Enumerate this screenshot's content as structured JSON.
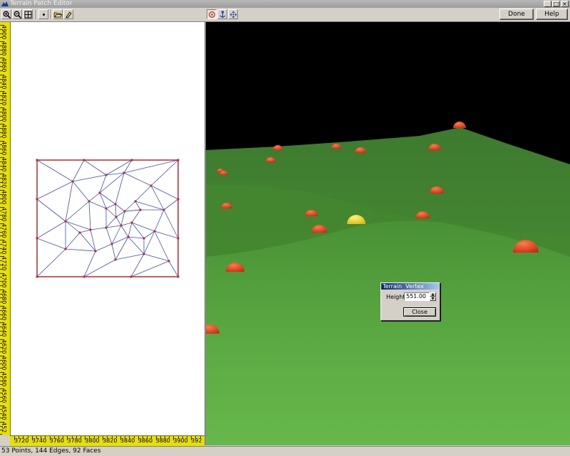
{
  "window": {
    "title": "Terrain Patch Editor",
    "controls": [
      "_",
      "□",
      "×"
    ]
  },
  "toolbar": {
    "left_tools": [
      "zoom-in-icon",
      "zoom-out-icon",
      "zoom-extents-icon",
      "point-icon",
      "open-folder-icon",
      "paint-icon"
    ],
    "view_tools": [
      "orbit-icon",
      "anchor-icon",
      "pan-icon"
    ],
    "done_label": "Done",
    "help_label": "Help"
  },
  "ruler_left": {
    "labels": [
      "4900",
      "4880",
      "4860",
      "4840",
      "4820",
      "4800",
      "4880",
      "4860",
      "4840",
      "4820",
      "4800",
      "4780",
      "4760",
      "4740",
      "4720",
      "4700",
      "4680",
      "4660",
      "4640",
      "4620",
      "4600",
      "4580",
      "4560",
      "4540",
      "452"
    ]
  },
  "ruler_bottom": {
    "labels": [
      "3720",
      "3740",
      "3760",
      "3780",
      "3800",
      "3820",
      "3840",
      "3860",
      "3880",
      "3900",
      "392"
    ]
  },
  "colors": {
    "sky": "#000000",
    "terrain_dark": "#3f7e30",
    "terrain_light": "#66b54a",
    "vertex_marker": "#e8401e",
    "selected_marker": "#f2d21a",
    "mesh_edge": "#3a4fc8",
    "boundary": "#c0282a",
    "ruler": "#e8e000"
  },
  "vertex_dialog": {
    "title": "Terrain  Vertex",
    "height_label": "Height",
    "height_value": "551.00",
    "close_label": "Close"
  },
  "status": {
    "text": "53 Points, 144 Edges, 92 Faces"
  }
}
